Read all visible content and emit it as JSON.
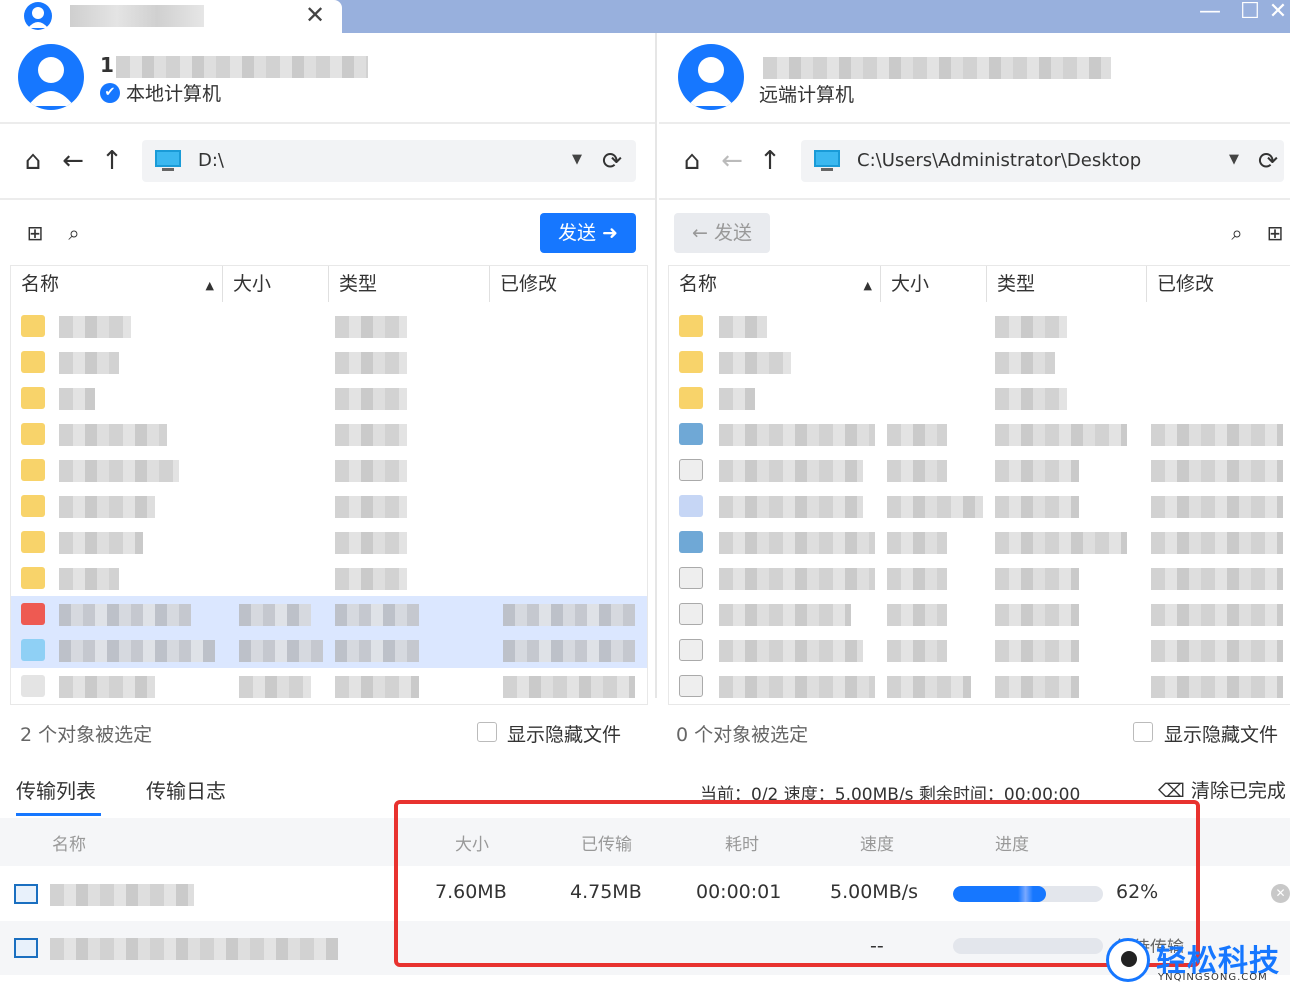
{
  "titlebar": {
    "tab_close": "✕",
    "minimize": "—",
    "maximize": "☐",
    "close": "✕"
  },
  "local": {
    "name_initial": "1",
    "subtitle": "本地计算机",
    "path": "D:\\",
    "columns": [
      "名称",
      "大小",
      "类型",
      "已修改"
    ],
    "status": "2 个对象被选定",
    "show_hidden": "显示隐藏文件"
  },
  "remote": {
    "subtitle": "远端计算机",
    "path": "C:\\Users\\Administrator\\Desktop",
    "send_back_label": "发送",
    "columns": [
      "名称",
      "大小",
      "类型",
      "已修改"
    ],
    "status": "0 个对象被选定",
    "show_hidden": "显示隐藏文件"
  },
  "toolbar": {
    "send_label": "发送"
  },
  "transfer": {
    "tabs": [
      "传输列表",
      "传输日志"
    ],
    "summary": "当前：0/2  速度：5.00MB/s  剩余时间：00:00:00",
    "clear_label": "清除已完成",
    "columns": [
      "名称",
      "大小",
      "已传输",
      "耗时",
      "速度",
      "进度"
    ],
    "rows": [
      {
        "size": "7.60MB",
        "transferred": "4.75MB",
        "elapsed": "00:00:01",
        "speed": "5.00MB/s",
        "progress_percent": 62,
        "progress_text": "62%"
      },
      {
        "size": "",
        "transferred": "",
        "elapsed": "",
        "speed": "--",
        "progress_percent": 0,
        "progress_text": "等待传输"
      }
    ]
  },
  "watermark": {
    "text": "轻松科技",
    "sub": "YNQINGSONG.COM"
  },
  "colors": {
    "accent": "#1677ff",
    "titlebar": "#98b0dd",
    "highlight": "#e8322f",
    "selected_row": "#dbe7ff"
  }
}
